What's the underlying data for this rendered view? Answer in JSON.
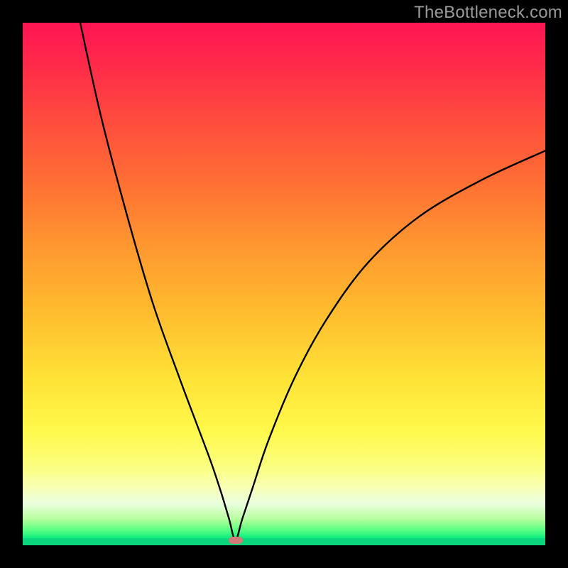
{
  "watermark": "TheBottleneck.com",
  "chart_data": {
    "type": "line",
    "title": "",
    "xlabel": "",
    "ylabel": "",
    "xlim": [
      0,
      100
    ],
    "ylim": [
      0,
      100
    ],
    "grid": false,
    "legend": false,
    "background": "rainbow-vertical",
    "series": [
      {
        "name": "bottleneck-curve",
        "x": [
          11,
          15,
          20,
          25,
          30,
          33,
          36,
          38,
          39.5,
          40.7,
          42,
          44,
          47,
          52,
          58,
          66,
          76,
          88,
          100
        ],
        "y": [
          100,
          82,
          63,
          46,
          32,
          24,
          16,
          10,
          5,
          1,
          5,
          11,
          20,
          32,
          43,
          54,
          63,
          70,
          75.5
        ]
      }
    ],
    "annotations": [
      {
        "name": "min-marker",
        "x": 40.7,
        "y": 1,
        "shape": "pill",
        "color": "#cf7b78"
      }
    ]
  },
  "colors": {
    "frame": "#000000",
    "gradient_top": "#ff1553",
    "gradient_bottom": "#0bd67d",
    "curve": "#000000",
    "marker": "#cf7b78",
    "watermark": "#9a9a9a"
  }
}
